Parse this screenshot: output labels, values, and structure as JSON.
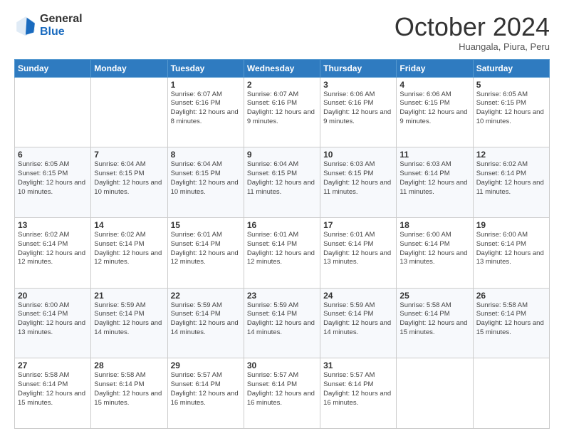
{
  "logo": {
    "general": "General",
    "blue": "Blue"
  },
  "header": {
    "month": "October 2024",
    "location": "Huangala, Piura, Peru"
  },
  "weekdays": [
    "Sunday",
    "Monday",
    "Tuesday",
    "Wednesday",
    "Thursday",
    "Friday",
    "Saturday"
  ],
  "weeks": [
    [
      {
        "day": "",
        "info": ""
      },
      {
        "day": "",
        "info": ""
      },
      {
        "day": "1",
        "info": "Sunrise: 6:07 AM\nSunset: 6:16 PM\nDaylight: 12 hours and 8 minutes."
      },
      {
        "day": "2",
        "info": "Sunrise: 6:07 AM\nSunset: 6:16 PM\nDaylight: 12 hours and 9 minutes."
      },
      {
        "day": "3",
        "info": "Sunrise: 6:06 AM\nSunset: 6:16 PM\nDaylight: 12 hours and 9 minutes."
      },
      {
        "day": "4",
        "info": "Sunrise: 6:06 AM\nSunset: 6:15 PM\nDaylight: 12 hours and 9 minutes."
      },
      {
        "day": "5",
        "info": "Sunrise: 6:05 AM\nSunset: 6:15 PM\nDaylight: 12 hours and 10 minutes."
      }
    ],
    [
      {
        "day": "6",
        "info": "Sunrise: 6:05 AM\nSunset: 6:15 PM\nDaylight: 12 hours and 10 minutes."
      },
      {
        "day": "7",
        "info": "Sunrise: 6:04 AM\nSunset: 6:15 PM\nDaylight: 12 hours and 10 minutes."
      },
      {
        "day": "8",
        "info": "Sunrise: 6:04 AM\nSunset: 6:15 PM\nDaylight: 12 hours and 10 minutes."
      },
      {
        "day": "9",
        "info": "Sunrise: 6:04 AM\nSunset: 6:15 PM\nDaylight: 12 hours and 11 minutes."
      },
      {
        "day": "10",
        "info": "Sunrise: 6:03 AM\nSunset: 6:15 PM\nDaylight: 12 hours and 11 minutes."
      },
      {
        "day": "11",
        "info": "Sunrise: 6:03 AM\nSunset: 6:14 PM\nDaylight: 12 hours and 11 minutes."
      },
      {
        "day": "12",
        "info": "Sunrise: 6:02 AM\nSunset: 6:14 PM\nDaylight: 12 hours and 11 minutes."
      }
    ],
    [
      {
        "day": "13",
        "info": "Sunrise: 6:02 AM\nSunset: 6:14 PM\nDaylight: 12 hours and 12 minutes."
      },
      {
        "day": "14",
        "info": "Sunrise: 6:02 AM\nSunset: 6:14 PM\nDaylight: 12 hours and 12 minutes."
      },
      {
        "day": "15",
        "info": "Sunrise: 6:01 AM\nSunset: 6:14 PM\nDaylight: 12 hours and 12 minutes."
      },
      {
        "day": "16",
        "info": "Sunrise: 6:01 AM\nSunset: 6:14 PM\nDaylight: 12 hours and 12 minutes."
      },
      {
        "day": "17",
        "info": "Sunrise: 6:01 AM\nSunset: 6:14 PM\nDaylight: 12 hours and 13 minutes."
      },
      {
        "day": "18",
        "info": "Sunrise: 6:00 AM\nSunset: 6:14 PM\nDaylight: 12 hours and 13 minutes."
      },
      {
        "day": "19",
        "info": "Sunrise: 6:00 AM\nSunset: 6:14 PM\nDaylight: 12 hours and 13 minutes."
      }
    ],
    [
      {
        "day": "20",
        "info": "Sunrise: 6:00 AM\nSunset: 6:14 PM\nDaylight: 12 hours and 13 minutes."
      },
      {
        "day": "21",
        "info": "Sunrise: 5:59 AM\nSunset: 6:14 PM\nDaylight: 12 hours and 14 minutes."
      },
      {
        "day": "22",
        "info": "Sunrise: 5:59 AM\nSunset: 6:14 PM\nDaylight: 12 hours and 14 minutes."
      },
      {
        "day": "23",
        "info": "Sunrise: 5:59 AM\nSunset: 6:14 PM\nDaylight: 12 hours and 14 minutes."
      },
      {
        "day": "24",
        "info": "Sunrise: 5:59 AM\nSunset: 6:14 PM\nDaylight: 12 hours and 14 minutes."
      },
      {
        "day": "25",
        "info": "Sunrise: 5:58 AM\nSunset: 6:14 PM\nDaylight: 12 hours and 15 minutes."
      },
      {
        "day": "26",
        "info": "Sunrise: 5:58 AM\nSunset: 6:14 PM\nDaylight: 12 hours and 15 minutes."
      }
    ],
    [
      {
        "day": "27",
        "info": "Sunrise: 5:58 AM\nSunset: 6:14 PM\nDaylight: 12 hours and 15 minutes."
      },
      {
        "day": "28",
        "info": "Sunrise: 5:58 AM\nSunset: 6:14 PM\nDaylight: 12 hours and 15 minutes."
      },
      {
        "day": "29",
        "info": "Sunrise: 5:57 AM\nSunset: 6:14 PM\nDaylight: 12 hours and 16 minutes."
      },
      {
        "day": "30",
        "info": "Sunrise: 5:57 AM\nSunset: 6:14 PM\nDaylight: 12 hours and 16 minutes."
      },
      {
        "day": "31",
        "info": "Sunrise: 5:57 AM\nSunset: 6:14 PM\nDaylight: 12 hours and 16 minutes."
      },
      {
        "day": "",
        "info": ""
      },
      {
        "day": "",
        "info": ""
      }
    ]
  ]
}
